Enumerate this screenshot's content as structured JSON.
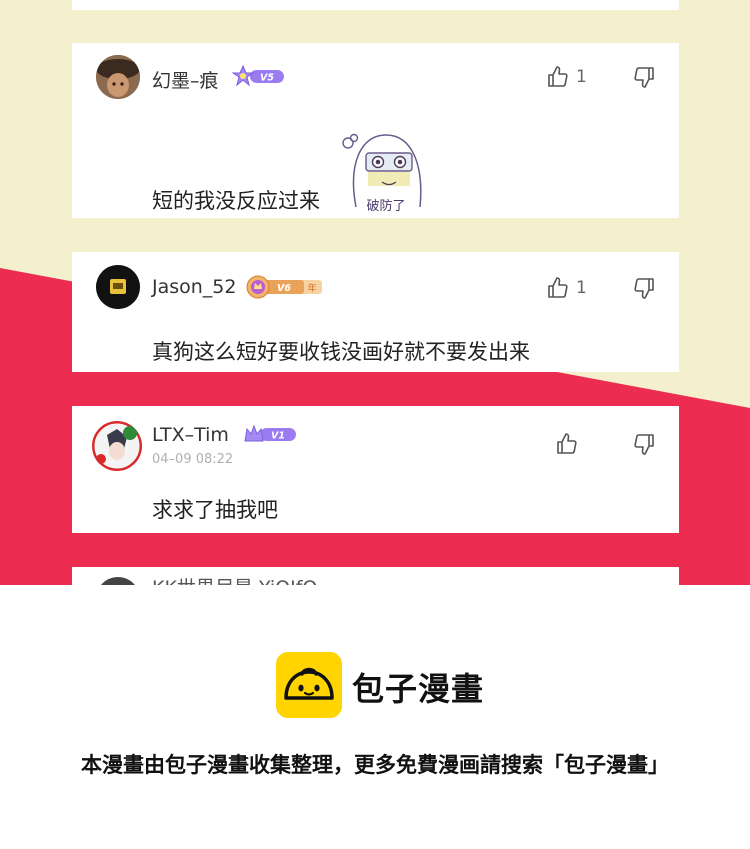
{
  "comments": [
    {
      "username": "幻墨–痕",
      "vip_badge": "V5",
      "text": "短的我没反应过来",
      "likes": "1",
      "sticker_text": "破防了",
      "avatar_icon": "avatar-brown-hat-icon"
    },
    {
      "username": "Jason_52",
      "vip_badge": "V6",
      "vip_suffix": "年",
      "text": "真狗这么短好要收钱没画好就不要发出来",
      "likes": "1",
      "avatar_icon": "avatar-dark-icon"
    },
    {
      "username": "LTX–Tim",
      "vip_badge": "V1",
      "time": "04–09 08:22",
      "text": "求求了抽我吧",
      "avatar_icon": "avatar-christmas-frame-icon"
    },
    {
      "username": "KK世界尽是 YiQIfO",
      "avatar_icon": "avatar-partial-icon"
    }
  ],
  "footer": {
    "brand": "包子漫畫",
    "notice": "本漫畫由包子漫畫收集整理，更多免費漫画請搜索「包子漫畫」",
    "logo_icon": "baozi-logo-icon"
  },
  "colors": {
    "cream_background": "#f4efcc",
    "red_band": "#ec2c50",
    "vip_purple": "#9a7cf0",
    "logo_yellow": "#ffd400"
  }
}
